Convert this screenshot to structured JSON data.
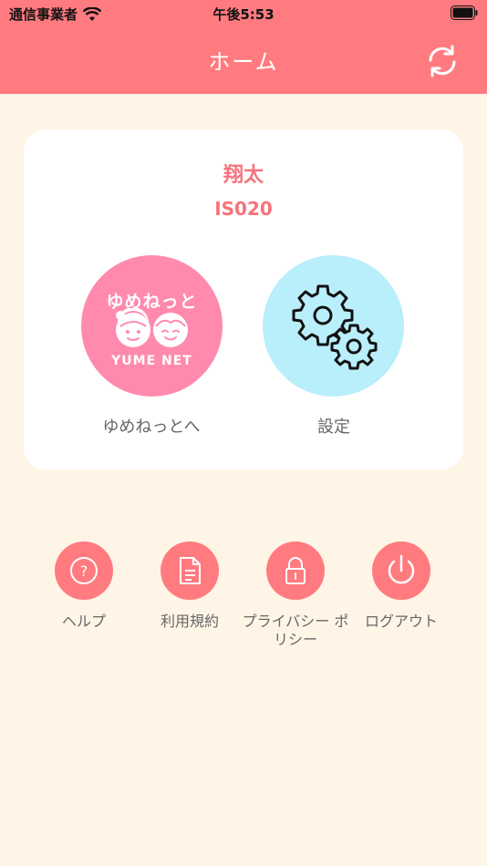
{
  "status_bar": {
    "carrier": "通信事業者",
    "time": "午後5:53"
  },
  "nav": {
    "title": "ホーム"
  },
  "user": {
    "name": "翔太",
    "id": "IS020"
  },
  "main_buttons": {
    "yume_label": "ゆめねっとへ",
    "settings_label": "設定",
    "logo_jp": "ゆめねっと",
    "logo_en": "YUME NET"
  },
  "menu": [
    {
      "label": "ヘルプ",
      "icon": "help-icon"
    },
    {
      "label": "利用規約",
      "icon": "document-icon"
    },
    {
      "label": "プライバシー ポリシー",
      "icon": "lock-icon"
    },
    {
      "label": "ログアウト",
      "icon": "power-icon"
    }
  ],
  "colors": {
    "accent": "#FF7B80",
    "background": "#FFF5E6",
    "yume_pink": "#FF8AAE",
    "settings_blue": "#B9EEFB",
    "text_accent": "#F7737B"
  }
}
